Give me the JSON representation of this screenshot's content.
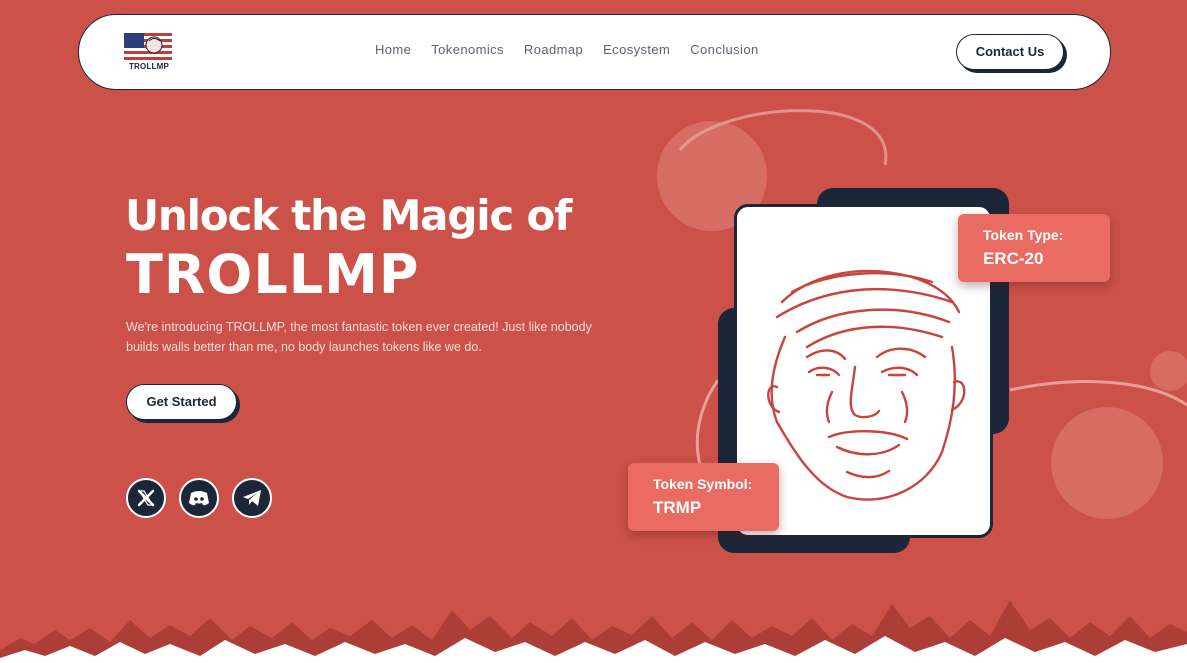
{
  "brand": {
    "name": "TROLLMP",
    "logo_icon": "trollmp-flag-logo"
  },
  "nav": {
    "links": [
      "Home",
      "Tokenomics",
      "Roadmap",
      "Ecosystem",
      "Conclusion"
    ],
    "contact_label": "Contact Us"
  },
  "hero": {
    "title_line1": "Unlock the Magic of",
    "title_line2": "TROLLMP",
    "description": "We're introducing TROLLMP, the most fantastic token ever created! Just like nobody builds walls better than me, no body launches tokens like we do.",
    "cta_label": "Get Started"
  },
  "socials": [
    {
      "name": "x",
      "icon": "x-icon"
    },
    {
      "name": "discord",
      "icon": "discord-icon"
    },
    {
      "name": "telegram",
      "icon": "telegram-icon"
    }
  ],
  "token_card": {
    "type_label": "Token Type:",
    "type_value": "ERC-20",
    "symbol_label": "Token Symbol:",
    "symbol_value": "TRMP"
  },
  "colors": {
    "background": "#cc5249",
    "navy": "#1b2638",
    "tag": "#ea6b62",
    "white": "#ffffff"
  }
}
